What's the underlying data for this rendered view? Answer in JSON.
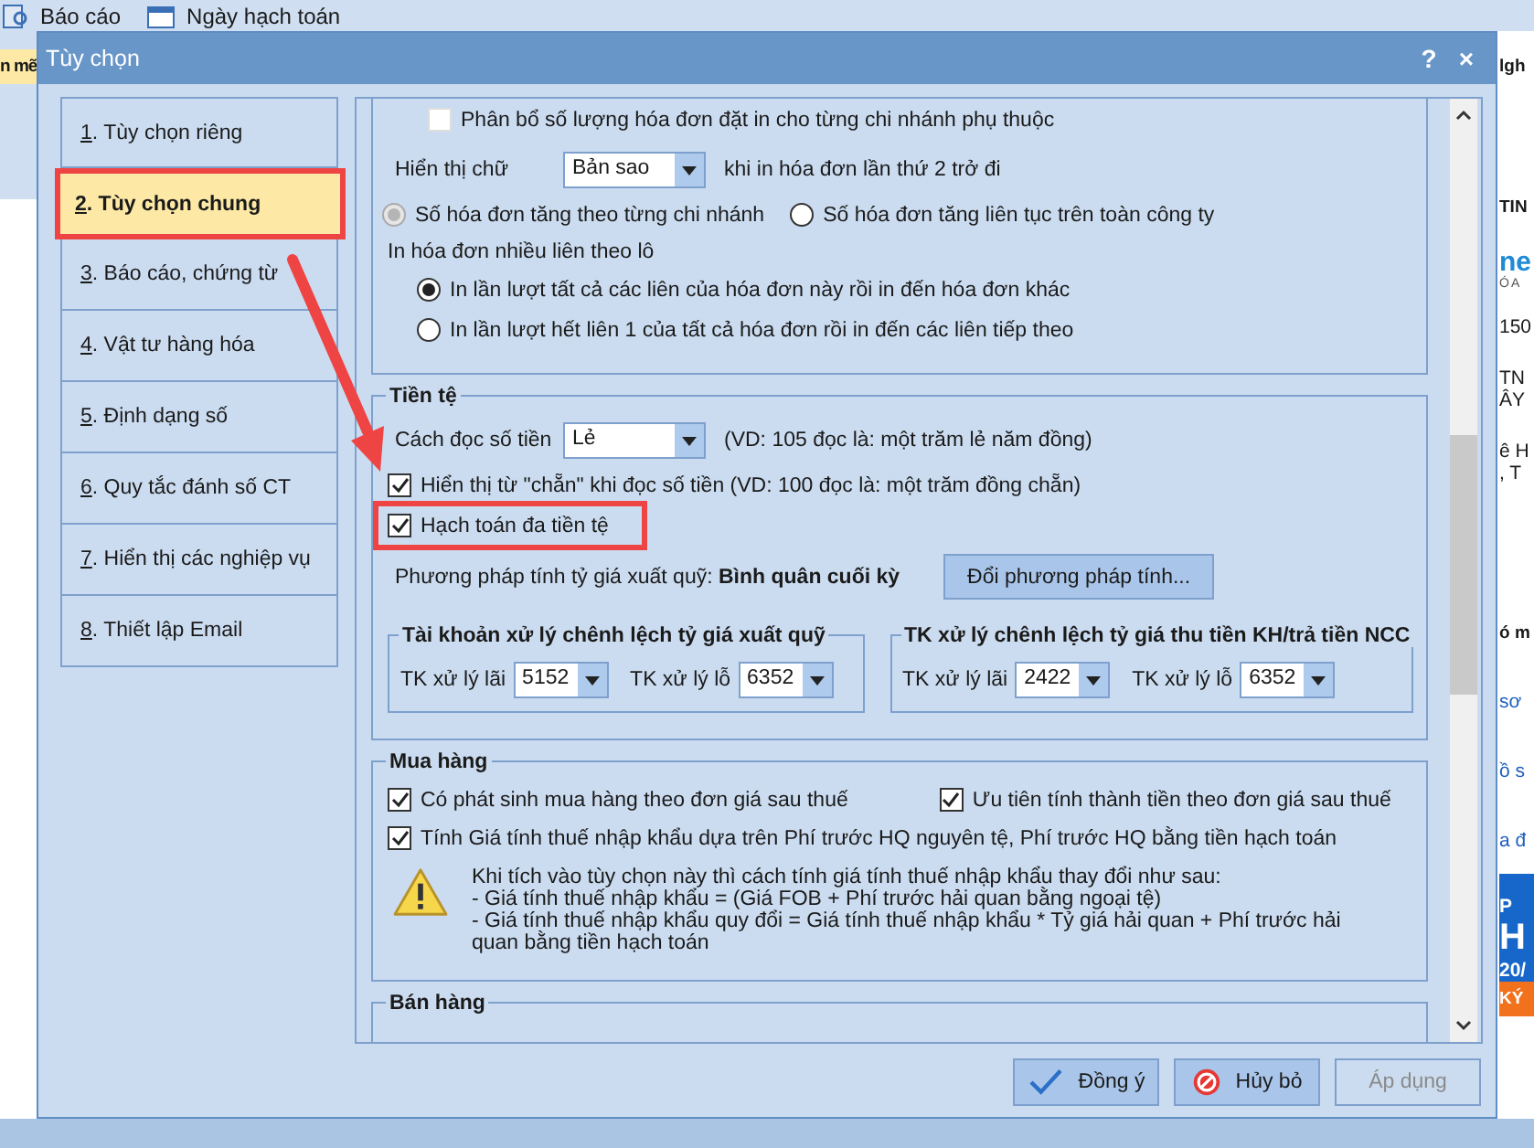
{
  "app": {
    "menu": [
      {
        "label": "Báo cáo"
      },
      {
        "label": "Ngày hạch toán"
      }
    ],
    "side_tab": "n mẽ",
    "right_fragments": [
      {
        "kind": "bold",
        "text": "lgh"
      },
      {
        "kind": "bold",
        "text": "TIN"
      },
      {
        "kind": "logo",
        "text": "ne"
      },
      {
        "kind": "small",
        "text": "ÓA"
      },
      {
        "kind": "plain",
        "text": "150"
      },
      {
        "kind": "plain",
        "text": "TN"
      },
      {
        "kind": "plain",
        "text": "ÂY"
      },
      {
        "kind": "plain",
        "text": "ê H"
      },
      {
        "kind": "plain",
        "text": ", T"
      },
      {
        "kind": "bold",
        "text": "ó m"
      },
      {
        "kind": "link",
        "text": "sơ"
      },
      {
        "kind": "link",
        "text": "ồ s"
      },
      {
        "kind": "link",
        "text": "a đ"
      },
      {
        "kind": "banner",
        "text": "P"
      },
      {
        "kind": "banner-big",
        "text": "H"
      },
      {
        "kind": "banner",
        "text": "20/"
      },
      {
        "kind": "cta",
        "text": "KÝ"
      }
    ]
  },
  "dialog": {
    "title": "Tùy chọn",
    "help": "?",
    "close": "×",
    "nav": [
      {
        "label": "1. Tùy chọn riêng",
        "selected": false,
        "highlighted": false
      },
      {
        "label": "2. Tùy chọn chung",
        "selected": true,
        "highlighted": true
      },
      {
        "label": "3. Báo cáo, chứng từ",
        "selected": false,
        "highlighted": false
      },
      {
        "label": "4. Vật tư hàng hóa",
        "selected": false,
        "highlighted": false
      },
      {
        "label": "5. Định dạng số",
        "selected": false,
        "highlighted": false
      },
      {
        "label": "6. Quy tắc đánh số CT",
        "selected": false,
        "highlighted": false
      },
      {
        "label": "7. Hiển thị các nghiệp vụ",
        "selected": false,
        "highlighted": false
      },
      {
        "label": "8. Thiết lập Email",
        "selected": false,
        "highlighted": false
      }
    ],
    "sections": [
      {
        "rows": [
          {
            "kind": "checkbox",
            "label": "Phân bổ số lượng hóa đơn đặt in cho từng chi nhánh phụ thuộc",
            "checked": false,
            "highlighted": false
          },
          {
            "kind": "combo",
            "label": "Hiển thị chữ",
            "value": "Bản sao",
            "note": "khi in hóa đơn lần thứ 2 trở đi"
          },
          {
            "kind": "radios",
            "options": [
              {
                "label": "Số hóa đơn tăng theo từng chi nhánh",
                "selected": true,
                "disabled": true
              },
              {
                "label": "Số hóa đơn tăng liên tục trên toàn công ty",
                "selected": false,
                "disabled": false
              }
            ]
          },
          {
            "kind": "text",
            "label": "In hóa đơn nhiều liên theo lô"
          },
          {
            "kind": "radio-list",
            "options": [
              {
                "label": "In lần lượt tất cả các liên của hóa đơn này rồi in đến hóa đơn khác",
                "selected": true,
                "disabled": false
              },
              {
                "label": "In lần lượt hết liên 1 của tất cả hóa đơn rồi in đến các liên tiếp theo",
                "selected": false,
                "disabled": false
              }
            ]
          }
        ]
      },
      {
        "title": "Tiền tệ",
        "rows": [
          {
            "kind": "combo",
            "label": "Cách đọc số tiền",
            "value": "Lẻ",
            "note": "(VD: 105 đọc là: một trăm lẻ năm đồng)"
          },
          {
            "kind": "checkbox",
            "label": "Hiển thị từ \"chẵn\" khi đọc số tiền (VD: 100 đọc là: một trăm đồng chẵn)",
            "checked": true,
            "highlighted": false
          },
          {
            "kind": "checkbox",
            "label": "Hạch toán đa tiền tệ",
            "checked": true,
            "highlighted": true
          },
          {
            "kind": "method",
            "label": "Phương pháp tính tỷ giá xuất quỹ: **Bình quân cuối kỳ**",
            "button": "Đổi phương pháp tính..."
          },
          {
            "kind": "groups",
            "groups": [
              {
                "title": "Tài khoản xử lý chênh lệch tỷ giá xuất quỹ",
                "fields": [
                  {
                    "label": "TK xử lý lãi",
                    "value": "5152"
                  },
                  {
                    "label": "TK xử lý lỗ",
                    "value": "6352"
                  }
                ]
              },
              {
                "title": "TK xử lý chênh lệch tỷ giá thu tiền KH/trả tiền NCC",
                "fields": [
                  {
                    "label": "TK xử lý lãi",
                    "value": "2422"
                  },
                  {
                    "label": "TK xử lý lỗ",
                    "value": "6352"
                  }
                ]
              }
            ]
          }
        ]
      },
      {
        "title": "Mua hàng",
        "rows": [
          {
            "kind": "checkbox-pair",
            "items": [
              {
                "label": "Có phát sinh mua hàng theo đơn giá sau thuế",
                "checked": true
              },
              {
                "label": "Ưu tiên tính thành tiền theo đơn giá sau thuế",
                "checked": true
              }
            ]
          },
          {
            "kind": "checkbox",
            "label": "Tính Giá tính thuế nhập khẩu dựa trên Phí trước HQ nguyên tệ, Phí trước HQ bằng tiền hạch toán",
            "checked": true,
            "highlighted": false
          },
          {
            "kind": "warning",
            "lines": [
              "Khi tích vào tùy chọn này thì cách tính giá tính thuế nhập khẩu thay đổi như sau:",
              "- Giá tính thuế nhập khẩu = (Giá FOB + Phí trước hải quan bằng ngoại tệ)",
              "- Giá tính thuế nhập khẩu quy đổi = Giá tính thuế nhập khẩu * Tỷ giá hải quan + Phí trước hải quan bằng tiền hạch toán"
            ]
          }
        ]
      },
      {
        "title": "Bán hàng"
      }
    ],
    "buttons": [
      {
        "kind": "ok",
        "label": "Đồng ý",
        "disabled": false
      },
      {
        "kind": "cancel",
        "label": "Hủy bỏ",
        "disabled": false
      },
      {
        "kind": "apply",
        "label": "Áp dụng",
        "disabled": true
      }
    ]
  }
}
